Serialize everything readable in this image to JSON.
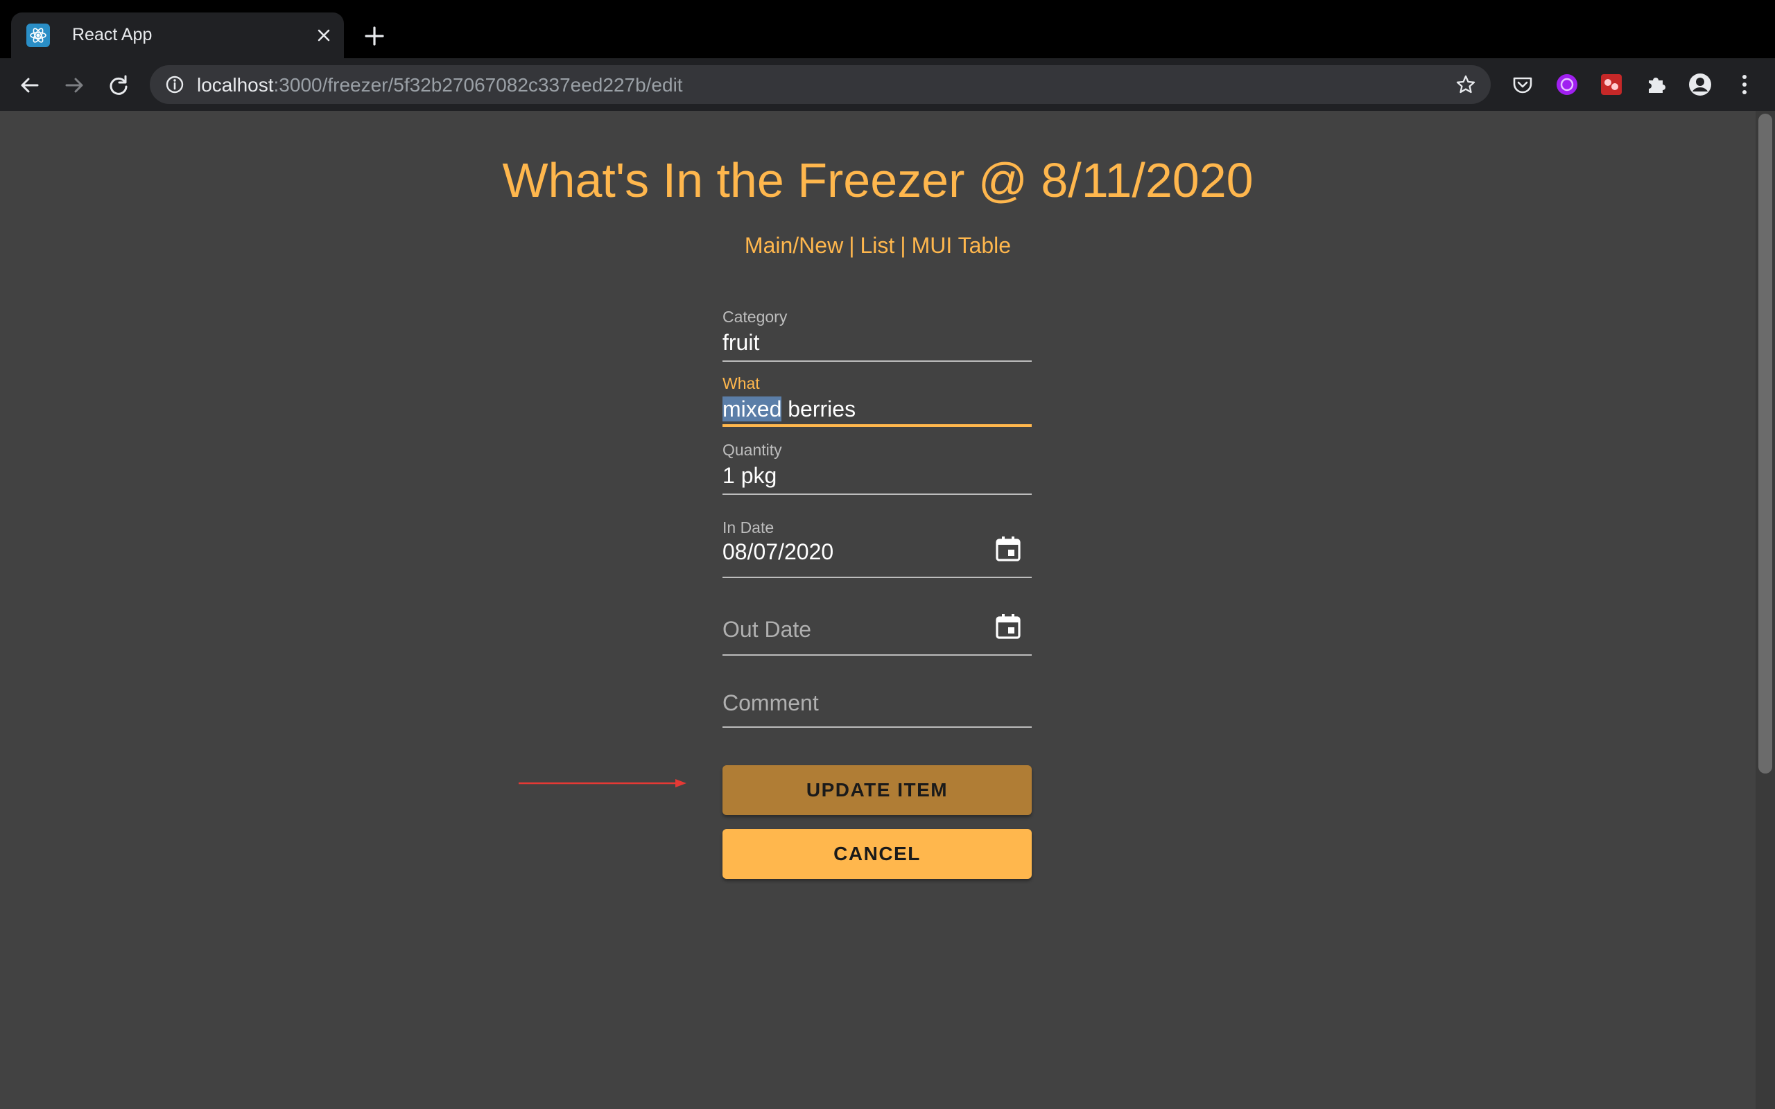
{
  "browser": {
    "tab_title": "React App",
    "url_host": "localhost",
    "url_path": ":3000/freezer/5f32b27067082c337eed227b/edit"
  },
  "page": {
    "title": "What's In the Freezer @ 8/11/2020",
    "nav": {
      "main_new": "Main/New",
      "separator": "|",
      "list": "List",
      "mui_table": "MUI Table"
    }
  },
  "form": {
    "category": {
      "label": "Category",
      "value": "fruit"
    },
    "what": {
      "label": "What",
      "value_selected": "mixed",
      "value_rest": " berries"
    },
    "quantity": {
      "label": "Quantity",
      "value": "1 pkg"
    },
    "in_date": {
      "label": "In Date",
      "value": "08/07/2020"
    },
    "out_date": {
      "placeholder": "Out Date"
    },
    "comment": {
      "placeholder": "Comment"
    },
    "update_button": "UPDATE ITEM",
    "cancel_button": "CANCEL"
  },
  "colors": {
    "accent": "#ffb74d",
    "update_button": "#b07d35",
    "background": "#424242",
    "arrow": "#e53935"
  },
  "icons": [
    "react-icon",
    "close-icon",
    "plus-icon",
    "back-icon",
    "forward-icon",
    "reload-icon",
    "info-icon",
    "star-icon",
    "pocket-icon",
    "extension-purple-icon",
    "extension-red-icon",
    "puzzle-icon",
    "profile-icon",
    "menu-dots-icon",
    "calendar-icon",
    "arrow-annotation"
  ]
}
